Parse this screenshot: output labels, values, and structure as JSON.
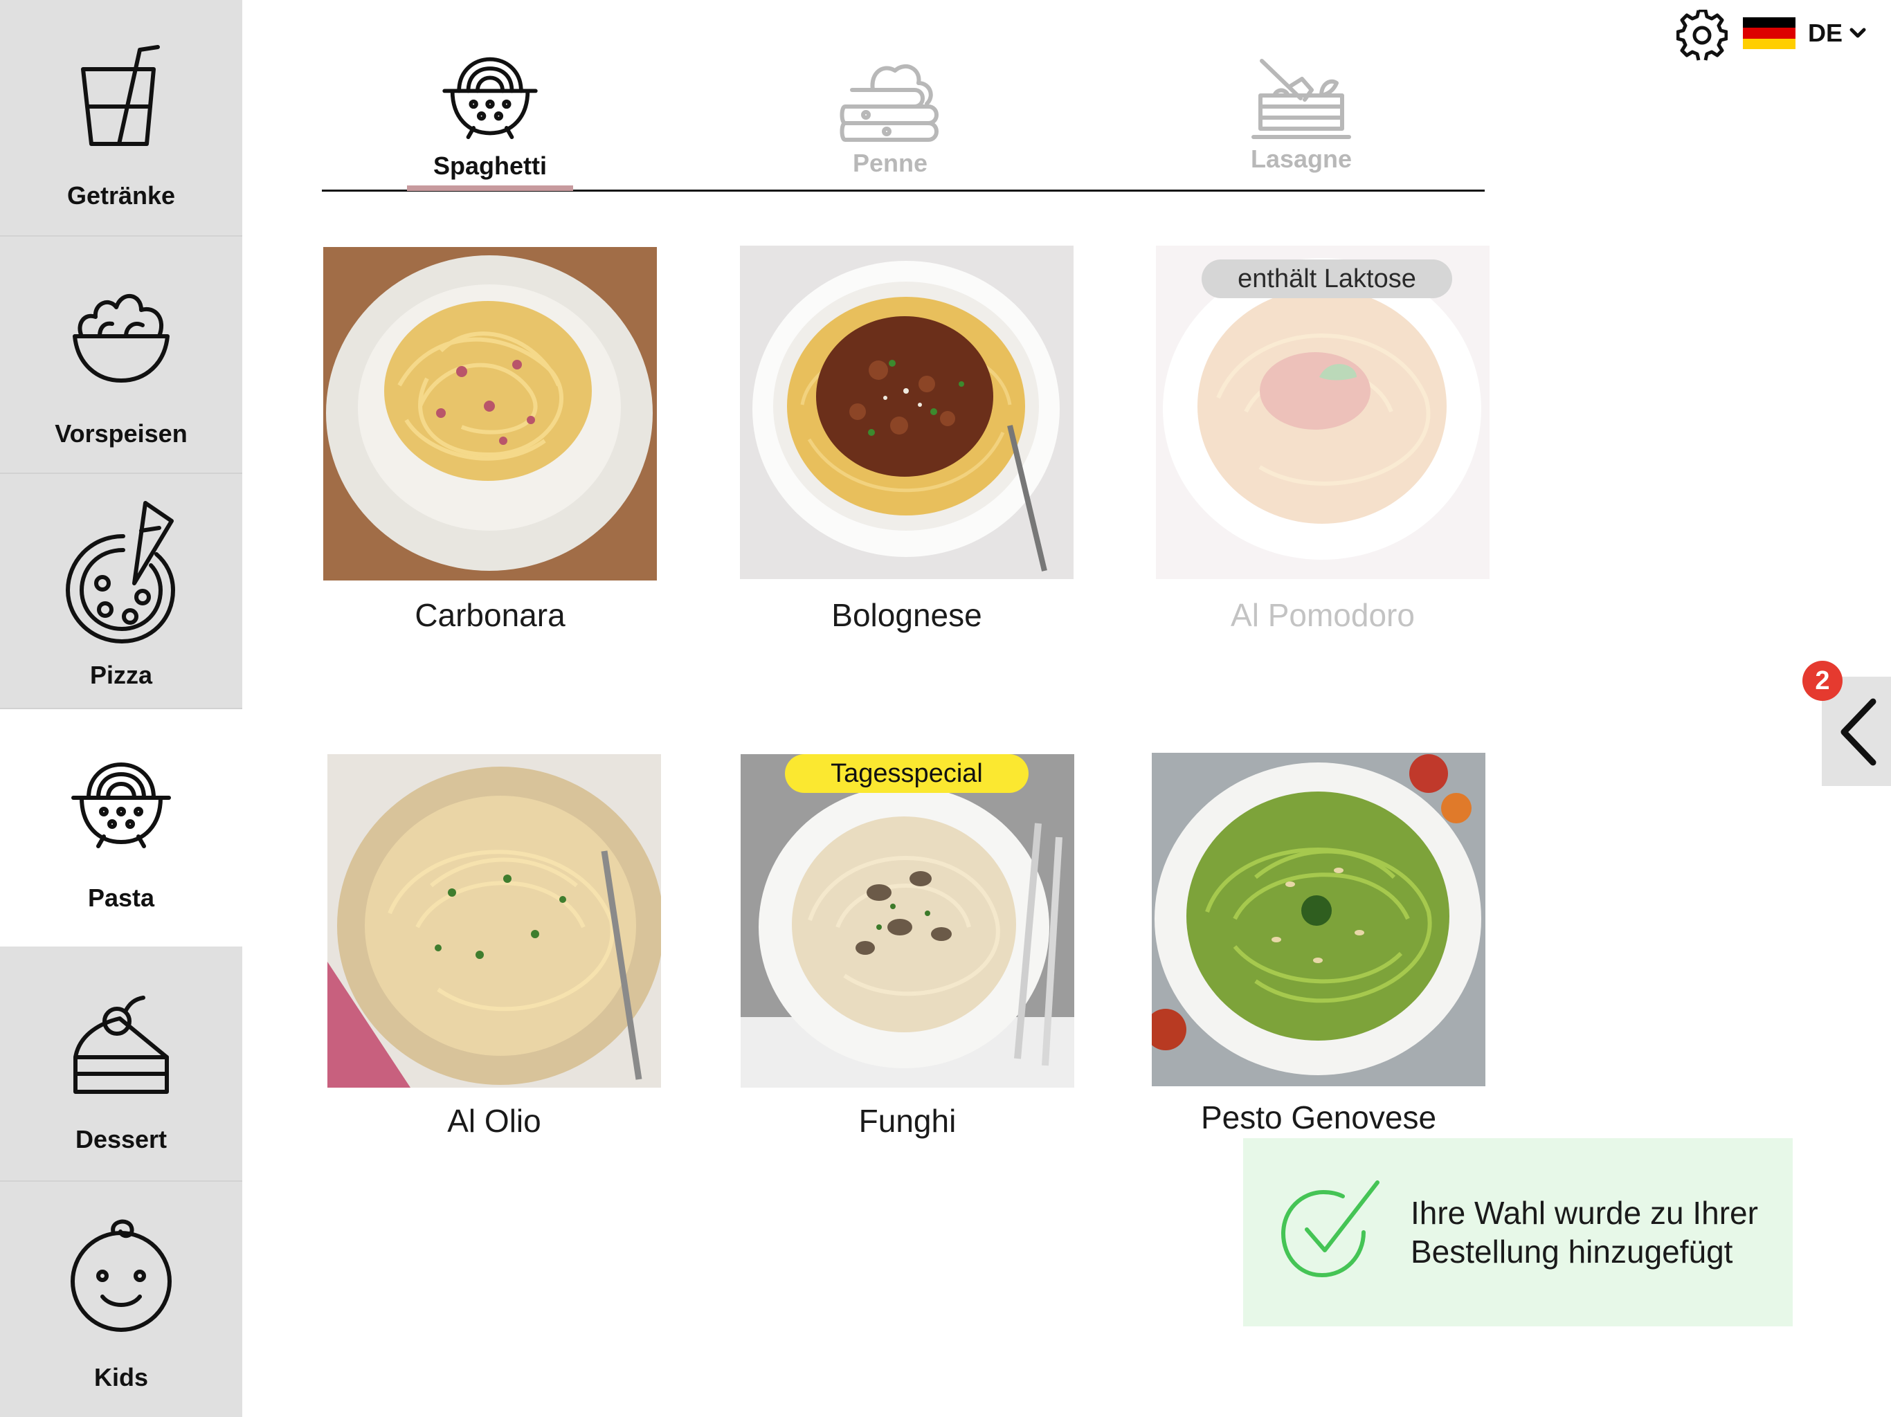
{
  "sidebar": {
    "items": [
      {
        "label": "Getränke",
        "icon": "drink-icon",
        "active": false
      },
      {
        "label": "Vorspeisen",
        "icon": "salad-bowl-icon",
        "active": false
      },
      {
        "label": "Pizza",
        "icon": "pizza-icon",
        "active": false
      },
      {
        "label": "Pasta",
        "icon": "pasta-colander-icon",
        "active": true
      },
      {
        "label": "Dessert",
        "icon": "cake-icon",
        "active": false
      },
      {
        "label": "Kids",
        "icon": "child-face-icon",
        "active": false
      }
    ]
  },
  "header": {
    "settings_icon": "gear-icon",
    "language": {
      "code": "DE",
      "flag": "german-flag-icon",
      "flag_colors": [
        "#000000",
        "#dd0000",
        "#ffce00"
      ]
    }
  },
  "tabs": [
    {
      "label": "Spaghetti",
      "icon": "pasta-colander-icon",
      "active": true
    },
    {
      "label": "Penne",
      "icon": "penne-icon",
      "active": false
    },
    {
      "label": "Lasagne",
      "icon": "lasagne-icon",
      "active": false
    }
  ],
  "products": [
    {
      "name": "Carbonara",
      "badge": "",
      "available": true
    },
    {
      "name": "Bolognese",
      "badge": "",
      "available": true
    },
    {
      "name": "Al Pomodoro",
      "badge": "enthält Laktose",
      "available": false
    },
    {
      "name": "Al Olio",
      "badge": "",
      "available": true
    },
    {
      "name": "Funghi",
      "badge": "Tagesspecial",
      "available": true
    },
    {
      "name": "Pesto Genovese",
      "badge": "",
      "available": true
    }
  ],
  "cart": {
    "count": "2",
    "icon": "chevron-left-icon"
  },
  "toast": {
    "message": "Ihre Wahl wurde zu Ihrer Bestellung hinzugefügt",
    "icon": "checkmark-icon"
  },
  "colors": {
    "sidebar_bg": "#e0e0e0",
    "active_tab_underline": "#c79a9e",
    "badge_red": "#e53a2f",
    "special_yellow": "#fbe830",
    "toast_bg": "#e7f8e8",
    "check_green": "#45c455"
  }
}
